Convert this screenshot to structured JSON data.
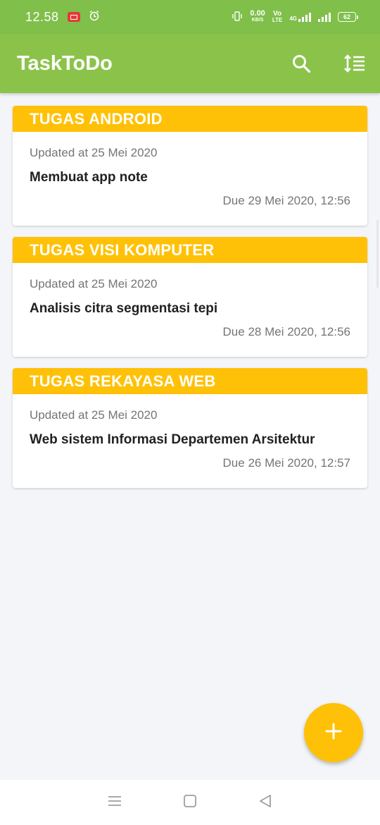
{
  "status_bar": {
    "time": "12.58",
    "net_speed_value": "0.00",
    "net_speed_unit": "KB/S",
    "volte_top": "Vo",
    "volte_bottom": "LTE",
    "network_type": "4G",
    "battery": "62"
  },
  "app_bar": {
    "title": "TaskToDo",
    "search_icon": "search-icon",
    "sort_icon": "sort-icon",
    "color": "#8bc34a"
  },
  "tasks": [
    {
      "category": "TUGAS ANDROID",
      "updated": "Updated at 25 Mei 2020",
      "name": "Membuat app note",
      "due": "Due 29 Mei 2020, 12:56"
    },
    {
      "category": "TUGAS VISI KOMPUTER",
      "updated": "Updated at 25 Mei 2020",
      "name": "Analisis citra segmentasi tepi",
      "due": "Due 28 Mei 2020, 12:56"
    },
    {
      "category": "TUGAS REKAYASA WEB",
      "updated": "Updated at 25 Mei 2020",
      "name": "Web sistem Informasi Departemen Arsitektur",
      "due": "Due 26 Mei 2020, 12:57"
    }
  ],
  "colors": {
    "accent": "#ffc107",
    "primary": "#8bc34a",
    "status_bar": "#7fbf4a"
  },
  "fab": {
    "icon": "plus-icon"
  },
  "nav": {
    "menu_icon": "menu-icon",
    "home_icon": "home-icon",
    "back_icon": "back-icon"
  }
}
